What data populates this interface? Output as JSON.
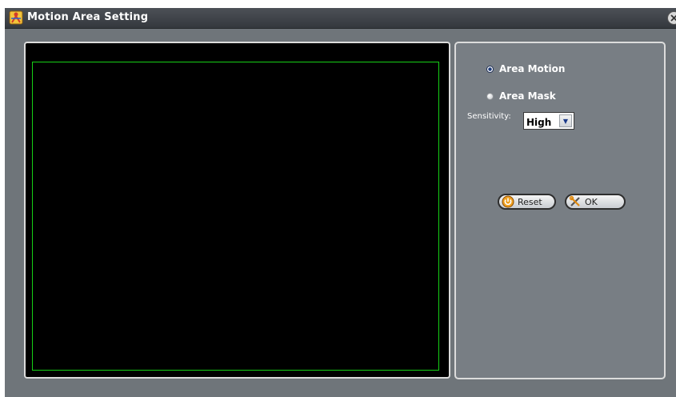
{
  "window": {
    "title": "Motion Area Setting",
    "title_icon": "app-logo-icon",
    "close_icon": "close-icon"
  },
  "preview": {
    "background": "#000000",
    "motion_area_color": "#16d016"
  },
  "settings": {
    "options": [
      {
        "label": "Area Motion",
        "selected": true
      },
      {
        "label": "Area Mask",
        "selected": false
      }
    ],
    "sensitivity": {
      "label": "Sensitivity:",
      "value": "High"
    },
    "buttons": {
      "reset_label": "Reset",
      "ok_label": "OK"
    }
  }
}
